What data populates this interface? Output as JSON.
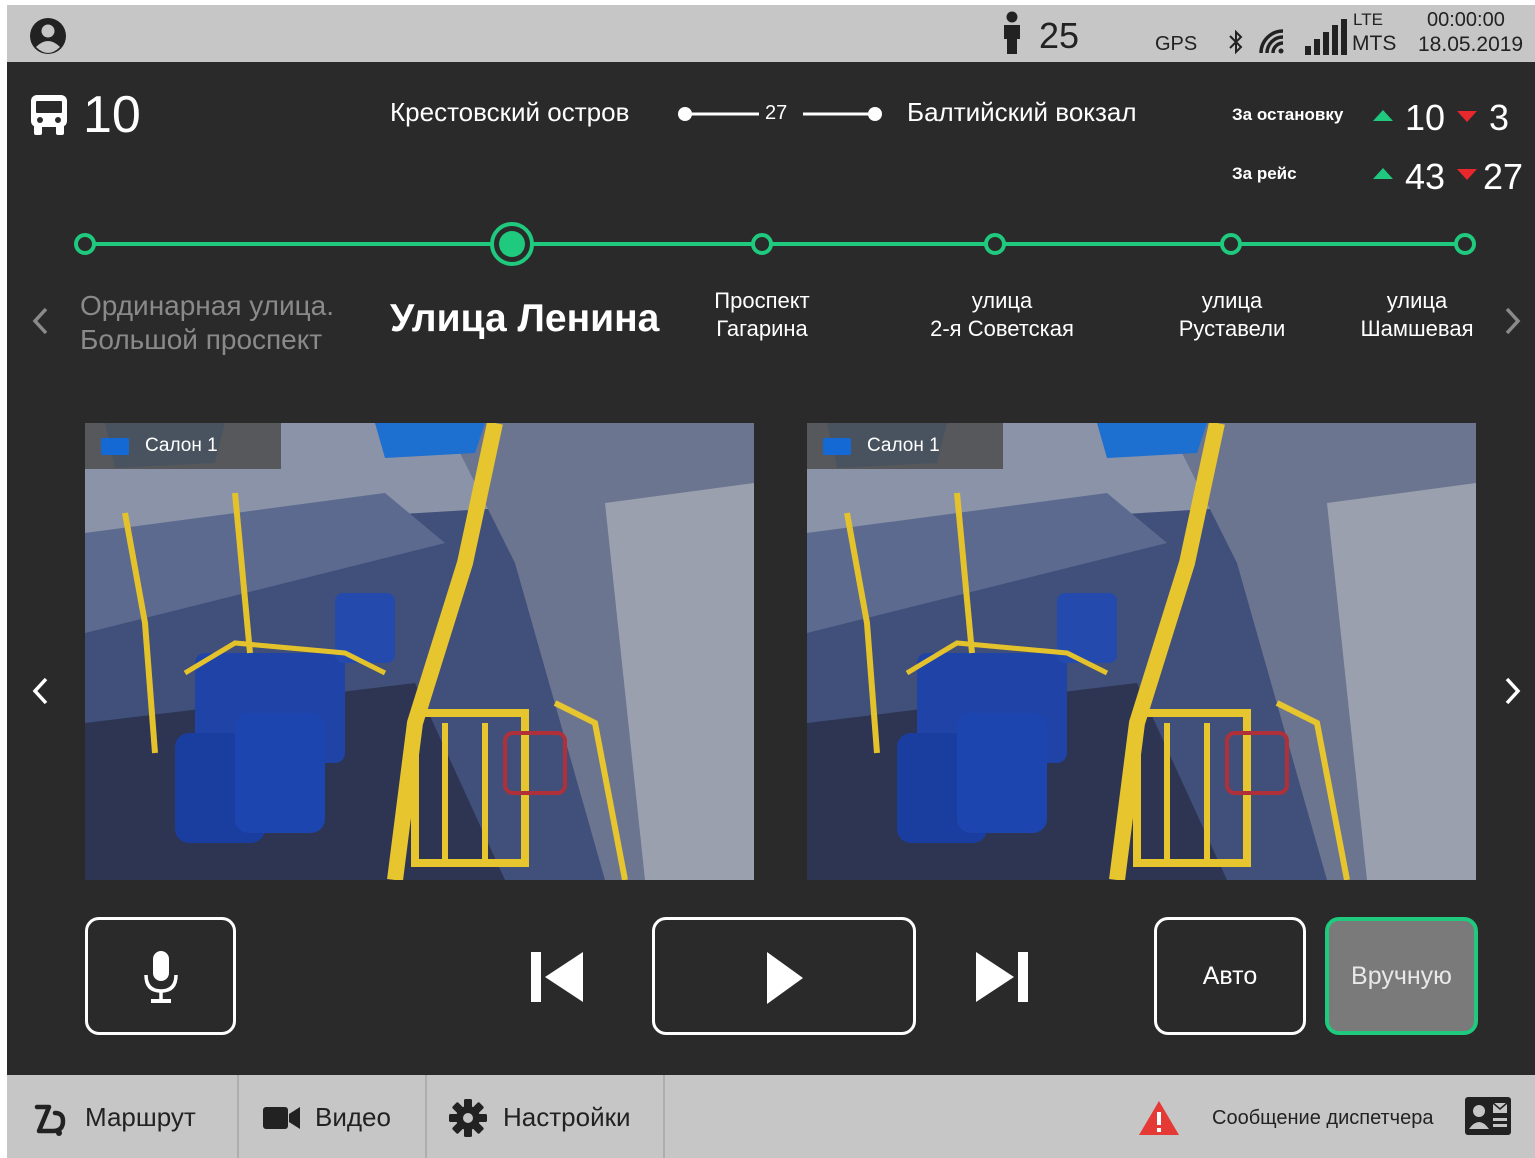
{
  "status_bar": {
    "passenger_count": "25",
    "gps_label": "GPS",
    "network_type": "LTE",
    "operator": "MTS",
    "time": "00:00:00",
    "date": "18.05.2019"
  },
  "route": {
    "number": "10",
    "from": "Крестовский остров",
    "stops_count": "27",
    "to": "Балтийский вокзал"
  },
  "stats": {
    "per_stop": {
      "label": "За остановку",
      "in": "10",
      "out": "3"
    },
    "per_trip": {
      "label": "За рейс",
      "in": "43",
      "out": "27"
    }
  },
  "stops": {
    "previous": [
      "Ординарная улица.",
      "Большой проспект"
    ],
    "current": "Улица Ленина",
    "next": [
      [
        "Проспект",
        "Гагарина"
      ],
      [
        "улица",
        "2-я Советская"
      ],
      [
        "улица",
        "Руставели"
      ],
      [
        "улица",
        "Шамшевая"
      ]
    ]
  },
  "videos": [
    {
      "label": "Салон 1"
    },
    {
      "label": "Салон 1"
    }
  ],
  "controls": {
    "auto_label": "Авто",
    "manual_label": "Вручную"
  },
  "nav": {
    "route_label": "Маршрут",
    "video_label": "Видео",
    "settings_label": "Настройки",
    "dispatcher_message": "Сообщение диспетчера"
  },
  "colors": {
    "accent_green": "#1fc97e",
    "down_red": "#e8282d",
    "alert_red": "#e53935",
    "background": "#2a2a2a",
    "bar_gray": "#c6c6c6"
  }
}
